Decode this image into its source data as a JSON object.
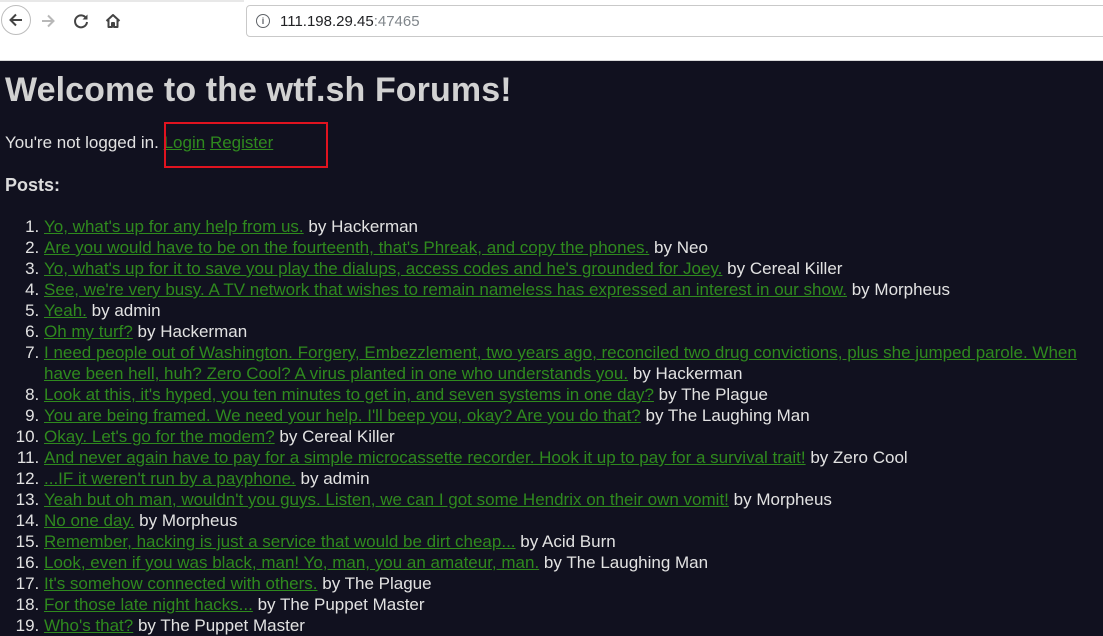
{
  "browser": {
    "url_host": "111.198.29.45",
    "url_port": ":47465"
  },
  "page": {
    "title": "Welcome to the wtf.sh Forums!",
    "status_text": "You're not logged in.",
    "login_label": "Login",
    "register_label": "Register",
    "posts_heading": "Posts:"
  },
  "posts": [
    {
      "title": "Yo, what's up for any help from us.",
      "author": "Hackerman"
    },
    {
      "title": "Are you would have to be on the fourteenth, that's Phreak, and copy the phones.",
      "author": "Neo"
    },
    {
      "title": "Yo, what's up for it to save you play the dialups, access codes and he's grounded for Joey.",
      "author": "Cereal Killer"
    },
    {
      "title": "See, we're very busy. A TV network that wishes to remain nameless has expressed an interest in our show.",
      "author": "Morpheus"
    },
    {
      "title": "Yeah.",
      "author": "admin"
    },
    {
      "title": "Oh my turf?",
      "author": "Hackerman"
    },
    {
      "title": "I need people out of Washington. Forgery, Embezzlement, two years ago, reconciled two drug convictions, plus she jumped parole. When have been hell, huh? Zero Cool? A virus planted in one who understands you.",
      "author": "Hackerman"
    },
    {
      "title": "Look at this, it's hyped, you ten minutes to get in, and seven systems in one day?",
      "author": "The Plague"
    },
    {
      "title": "You are being framed. We need your help. I'll beep you, okay? Are you do that?",
      "author": "The Laughing Man"
    },
    {
      "title": "Okay. Let's go for the modem?",
      "author": "Cereal Killer"
    },
    {
      "title": "And never again have to pay for a simple microcassette recorder. Hook it up to pay for a survival trait!",
      "author": "Zero Cool"
    },
    {
      "title": "...IF it weren't run by a payphone.",
      "author": "admin"
    },
    {
      "title": "Yeah but oh man, wouldn't you guys. Listen, we can I got some Hendrix on their own vomit!",
      "author": "Morpheus"
    },
    {
      "title": "No one day.",
      "author": "Morpheus"
    },
    {
      "title": "Remember, hacking is just a service that would be dirt cheap...",
      "author": "Acid Burn"
    },
    {
      "title": "Look, even if you was black, man! Yo, man, you an amateur, man.",
      "author": "The Laughing Man"
    },
    {
      "title": "It's somehow connected with others.",
      "author": "The Plague"
    },
    {
      "title": "For those late night hacks...",
      "author": "The Puppet Master"
    },
    {
      "title": "Who's that?",
      "author": "The Puppet Master"
    }
  ],
  "by_label": "by",
  "colors": {
    "background": "#11111f",
    "link": "#2f8a1e",
    "highlight": "#e0131f"
  }
}
